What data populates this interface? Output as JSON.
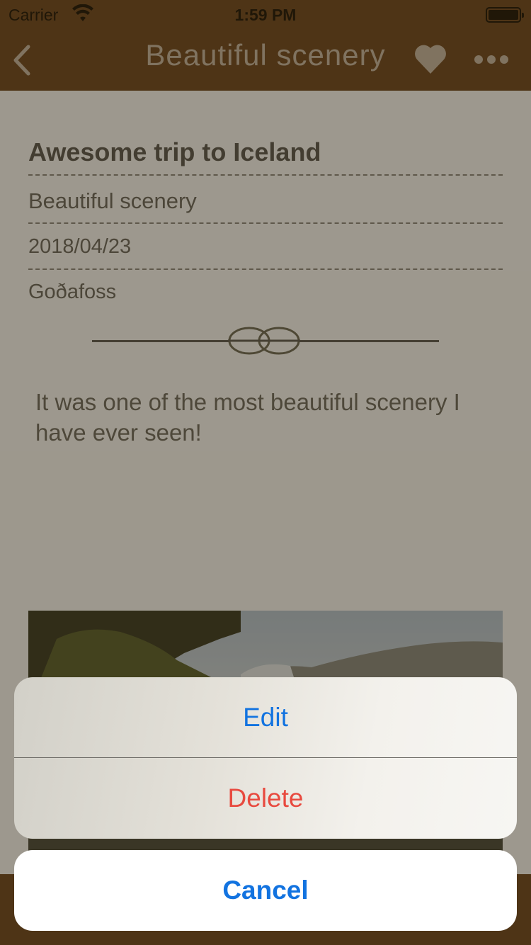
{
  "status_bar": {
    "carrier": "Carrier",
    "time": "1:59 PM"
  },
  "nav": {
    "title": "Beautiful scenery",
    "back_icon": "chevron-left-icon",
    "favorite_icon": "heart-icon",
    "more_icon": "ellipsis-icon"
  },
  "entry": {
    "title": "Awesome trip to Iceland",
    "subtitle": "Beautiful scenery",
    "date": "2018/04/23",
    "location": "Goðafoss",
    "body": "It was one of the most beautiful scenery I have ever seen!"
  },
  "action_sheet": {
    "edit_label": "Edit",
    "delete_label": "Delete",
    "cancel_label": "Cancel"
  },
  "colors": {
    "nav_background": "#6e4520",
    "action_blue": "#1273e0",
    "destructive_red": "#e84a3f"
  }
}
